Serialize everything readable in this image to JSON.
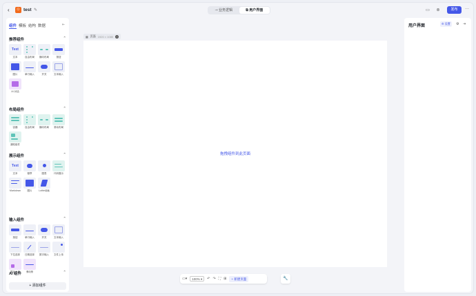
{
  "app": {
    "title": "test",
    "logo_glyph": "☺",
    "back_icon": "chevron-left-icon"
  },
  "header": {
    "modes": [
      {
        "label": "业务逻辑",
        "icon": "logic-icon",
        "glyph": "⊸"
      },
      {
        "label": "用户界面",
        "icon": "ui-icon",
        "glyph": "⧉",
        "active": true
      }
    ],
    "publish_label": "发布",
    "accent": "#4457e8"
  },
  "left": {
    "tabs": [
      "组件",
      "模板",
      "结构",
      "数据"
    ],
    "sections": [
      {
        "title": "推荐组件",
        "items": [
          {
            "label": "文本",
            "kind": "text",
            "glyph": "Text"
          },
          {
            "label": "自由布局",
            "kind": "freelayout"
          },
          {
            "label": "横向布局",
            "kind": "hlayout"
          },
          {
            "label": "按钮",
            "kind": "button"
          },
          {
            "label": "图片",
            "kind": "image"
          },
          {
            "label": "单行输入",
            "kind": "input"
          },
          {
            "label": "开关",
            "kind": "switch"
          },
          {
            "label": "文本输入",
            "kind": "textarea"
          },
          {
            "label": "AI 对话",
            "kind": "ai"
          }
        ]
      },
      {
        "title": "布局组件",
        "items": [
          {
            "label": "容器",
            "kind": "container"
          },
          {
            "label": "自由布局",
            "kind": "freelayout"
          },
          {
            "label": "横向布局",
            "kind": "hlayout"
          },
          {
            "label": "滚动布局",
            "kind": "scroll"
          },
          {
            "label": "通知组件",
            "kind": "notify"
          }
        ]
      },
      {
        "title": "展示组件",
        "items": [
          {
            "label": "文本",
            "kind": "text",
            "glyph": "Text"
          },
          {
            "label": "徽章",
            "kind": "badge"
          },
          {
            "label": "图表",
            "kind": "chart"
          },
          {
            "label": "代码展示",
            "kind": "code"
          },
          {
            "label": "Markdown",
            "kind": "markdown"
          },
          {
            "label": "图片",
            "kind": "image"
          },
          {
            "label": "Lottie动画",
            "kind": "lottie"
          }
        ]
      },
      {
        "title": "输入组件",
        "items": [
          {
            "label": "按钮",
            "kind": "button"
          },
          {
            "label": "单行输入",
            "kind": "input"
          },
          {
            "label": "开关",
            "kind": "switch"
          },
          {
            "label": "文本输入",
            "kind": "textarea"
          },
          {
            "label": "下拉选择",
            "kind": "select"
          },
          {
            "label": "日期选择",
            "kind": "date"
          },
          {
            "label": "数字输入",
            "kind": "number"
          },
          {
            "label": "文件上传",
            "kind": "file"
          },
          {
            "label": "图片上传",
            "kind": "imgupload"
          },
          {
            "label": "滑动条",
            "kind": "slider"
          }
        ]
      },
      {
        "title": "AI 组件",
        "items": []
      }
    ],
    "add_label": "+ 添加组件"
  },
  "canvas": {
    "page_name": "页面",
    "page_size": "1920 × 1080",
    "hint": "拖拽组件到此页面"
  },
  "toolbar": {
    "zoom": "100%",
    "new_page_label": "+ 新建页面"
  },
  "right": {
    "title": "用户界面",
    "badge": "设置"
  }
}
